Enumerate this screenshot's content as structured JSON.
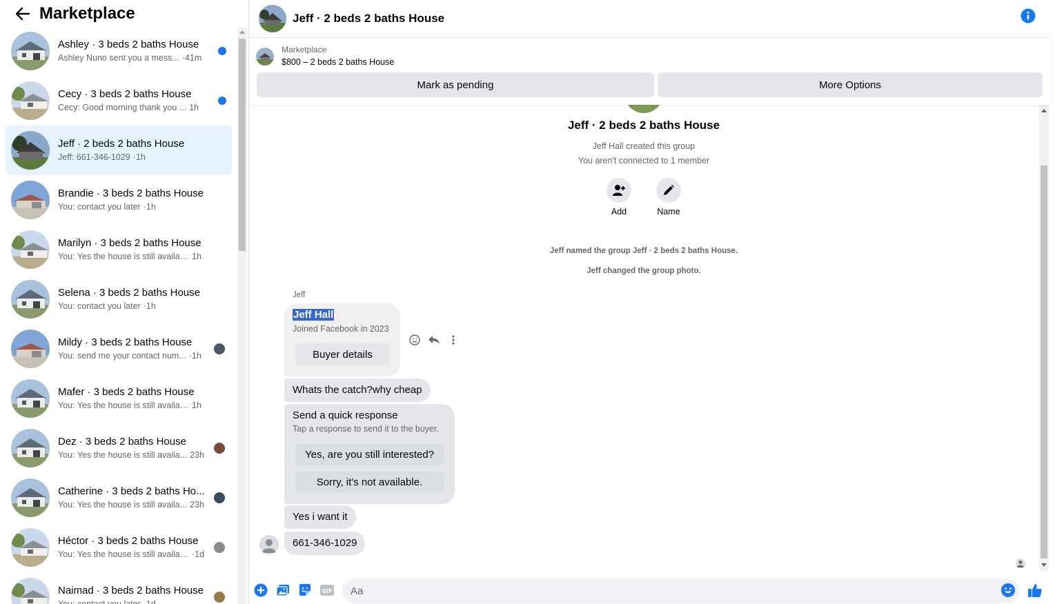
{
  "sidebar": {
    "title": "Marketplace",
    "conversations": [
      {
        "name": "Ashley · 3 beds 2 baths House",
        "snippet": "Ashley Nuno sent you a mess...",
        "time": "·41m",
        "unread": true,
        "photo": "house-white"
      },
      {
        "name": "Cecy · 3 beds 2 baths House",
        "snippet": "Cecy: Good morning thank you ...",
        "time": "1h",
        "unread": true,
        "photo": "house-tree"
      },
      {
        "name": "Jeff · 2 beds 2 baths House",
        "snippet": "Jeff: 661-346-1029",
        "time": "·1h",
        "unread": false,
        "active": true,
        "photo": "house-dark"
      },
      {
        "name": "Brandie · 3 beds 2 baths House",
        "snippet": "You: contact you later",
        "time": "·1h",
        "unread": false,
        "photo": "house-red"
      },
      {
        "name": "Marilyn · 3 beds 2 baths House",
        "snippet": "You: Yes the house is still available f...",
        "time": "1h",
        "unread": false,
        "photo": "house-tree"
      },
      {
        "name": "Selena · 3 beds 2 baths House",
        "snippet": "You: contact you later",
        "time": "·1h",
        "unread": false,
        "photo": "house-white"
      },
      {
        "name": "Mildy · 3 beds 2 baths House",
        "snippet": "You: send me your contact num...",
        "time": "·1h",
        "unread": false,
        "photo": "house-red"
      },
      {
        "name": "Mafer · 3 beds 2 baths House",
        "snippet": "You: Yes the house is still available f...",
        "time": "1h",
        "unread": false,
        "photo": "house-white"
      },
      {
        "name": "Dez · 3 beds 2 baths House",
        "snippet": "You: Yes the house is still availa...",
        "time": "23h",
        "unread": false,
        "photo": "house-white"
      },
      {
        "name": "Catherine · 3 beds 2 baths Ho...",
        "snippet": "You: Yes the house is still availa...",
        "time": "23h",
        "unread": false,
        "photo": "house-white"
      },
      {
        "name": "Héctor · 3 beds 2 baths House",
        "snippet": "You: Yes the house is still availab...",
        "time": "·1d",
        "unread": false,
        "photo": "house-tree"
      },
      {
        "name": "Naimad · 3 beds 2 baths House",
        "snippet": "You: contact you later",
        "time": "·1d",
        "unread": false,
        "photo": "house-tree"
      }
    ]
  },
  "chat": {
    "title": "Jeff · 2 beds 2 baths House",
    "marketplace_label": "Marketplace",
    "listing": "$800 – 2 beds 2 baths House",
    "mark_pending": "Mark as pending",
    "more_options": "More Options",
    "group_title": "Jeff · 2 beds 2 baths House",
    "created_by": "Jeff Hall created this group",
    "not_connected": "You aren't connected to 1 member",
    "add_label": "Add",
    "name_label": "Name",
    "sys_named": "Jeff named the group Jeff · 2 beds 2 baths House.",
    "sys_photo": "Jeff changed the group photo.",
    "sender": "Jeff",
    "profile_name": "Jeff Hall",
    "joined": "Joined Facebook in 2023",
    "buyer_details": "Buyer details",
    "msg1": "Whats the catch?why cheap",
    "quick_title": "Send a quick response",
    "quick_sub": "Tap a response to send it to the buyer.",
    "quick_1": "Yes, are you still interested?",
    "quick_2": "Sorry, it's not available.",
    "msg2": "Yes i want it",
    "msg3": "661-346-1029"
  },
  "composer": {
    "placeholder": "Aa"
  },
  "colors": {
    "accent": "#1877f2",
    "bubble": "#e4e6eb",
    "active_row": "#e7f3ff"
  }
}
